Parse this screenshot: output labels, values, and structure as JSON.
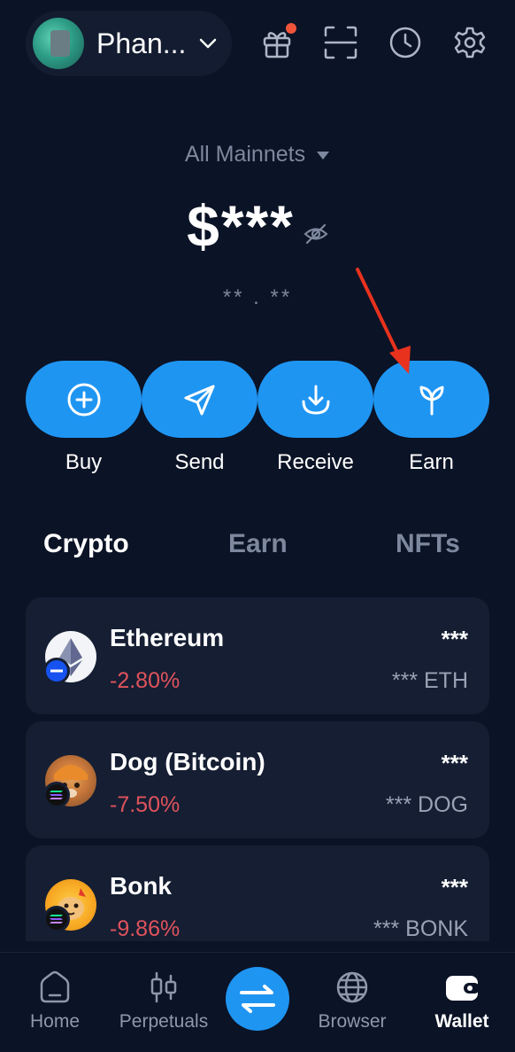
{
  "header": {
    "account_name": "Phan...",
    "icons": [
      "gift-icon",
      "scan-icon",
      "history-icon",
      "settings-icon"
    ]
  },
  "network": {
    "label": "All Mainnets"
  },
  "balance": {
    "value": "$***",
    "change": "** . **"
  },
  "actions": [
    {
      "label": "Buy",
      "icon": "plus-circle-icon"
    },
    {
      "label": "Send",
      "icon": "paper-plane-icon"
    },
    {
      "label": "Receive",
      "icon": "download-icon"
    },
    {
      "label": "Earn",
      "icon": "sprout-icon"
    }
  ],
  "tabs": [
    {
      "label": "Crypto",
      "active": true
    },
    {
      "label": "Earn",
      "active": false
    },
    {
      "label": "NFTs",
      "active": false
    }
  ],
  "tokens": [
    {
      "name": "Ethereum",
      "change": "-2.80%",
      "value": "***",
      "amount": "*** ETH"
    },
    {
      "name": "Dog (Bitcoin)",
      "change": "-7.50%",
      "value": "***",
      "amount": "*** DOG"
    },
    {
      "name": "Bonk",
      "change": "-9.86%",
      "value": "***",
      "amount": "*** BONK"
    }
  ],
  "bottom_nav": [
    {
      "label": "Home",
      "active": false
    },
    {
      "label": "Perpetuals",
      "active": false
    },
    {
      "label": "Swap",
      "active": false
    },
    {
      "label": "Browser",
      "active": false
    },
    {
      "label": "Wallet",
      "active": true
    }
  ],
  "colors": {
    "background": "#0b1326",
    "card": "#151e33",
    "accent": "#1f95f2",
    "negative": "#e0535c",
    "muted": "#7d889e",
    "notification": "#f0553a",
    "annotation_arrow": "#e8321e"
  }
}
